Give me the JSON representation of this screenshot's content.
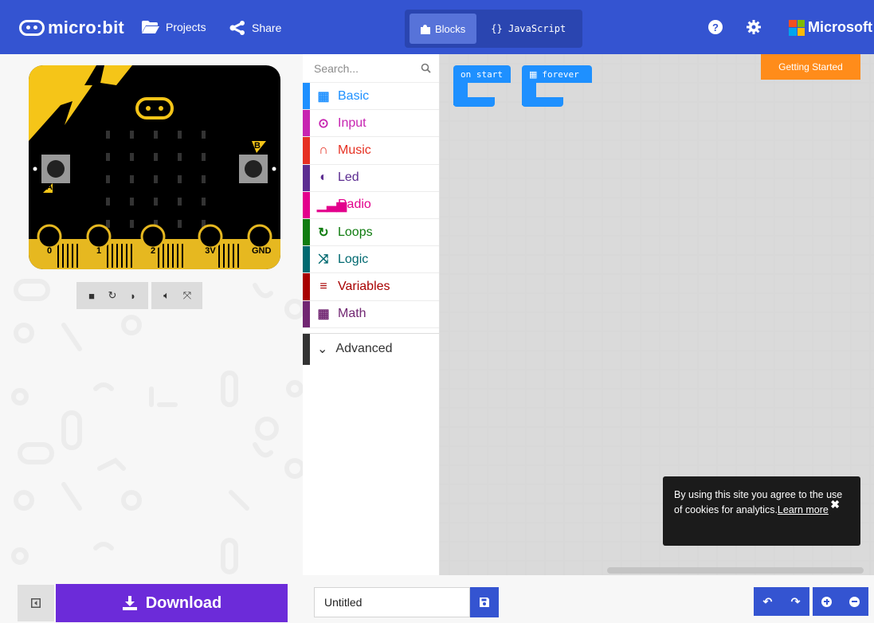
{
  "header": {
    "logo_text": "micro:bit",
    "projects_label": "Projects",
    "share_label": "Share",
    "modes": [
      {
        "label": "Blocks",
        "active": true
      },
      {
        "label": "{} JavaScript",
        "active": false
      }
    ],
    "microsoft_label": "Microsoft"
  },
  "simulator": {
    "pins": [
      "0",
      "1",
      "2",
      "3V",
      "GND"
    ],
    "button_a": "A",
    "button_b": "B",
    "controls": [
      "stop-icon",
      "restart-icon",
      "slowmo-icon",
      "sound-icon",
      "fullscreen-icon"
    ]
  },
  "toolbox": {
    "search_placeholder": "Search...",
    "categories": [
      {
        "label": "Basic",
        "color": "#1e90ff",
        "icon": "grid-icon"
      },
      {
        "label": "Input",
        "color": "#c724b1",
        "icon": "target-icon"
      },
      {
        "label": "Music",
        "color": "#e63022",
        "icon": "headphones-icon"
      },
      {
        "label": "Led",
        "color": "#5c2d91",
        "icon": "toggle-icon"
      },
      {
        "label": "Radio",
        "color": "#e3008c",
        "icon": "signal-icon"
      },
      {
        "label": "Loops",
        "color": "#107c10",
        "icon": "loop-icon"
      },
      {
        "label": "Logic",
        "color": "#006970",
        "icon": "shuffle-icon"
      },
      {
        "label": "Variables",
        "color": "#a80000",
        "icon": "list-icon"
      },
      {
        "label": "Math",
        "color": "#712672",
        "icon": "calculator-icon"
      }
    ],
    "advanced_label": "Advanced"
  },
  "workspace": {
    "blocks": [
      {
        "label": "on start"
      },
      {
        "label": "forever"
      }
    ],
    "getting_started": "Getting Started",
    "cookie": {
      "text": "By using this site you agree to the use of cookies for analytics.",
      "link": "Learn more"
    }
  },
  "footer": {
    "download_label": "Download",
    "project_name": "Untitled"
  }
}
